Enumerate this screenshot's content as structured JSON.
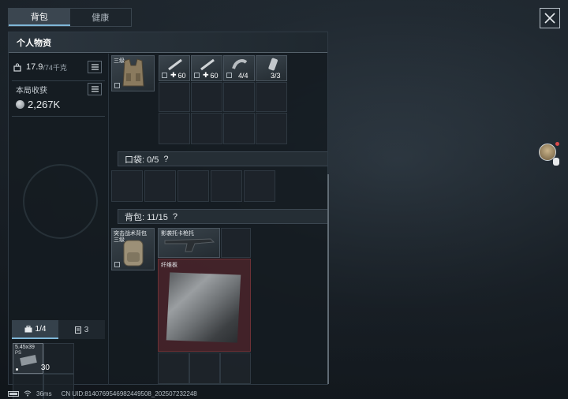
{
  "top_tabs": [
    {
      "label": "背包",
      "active": true
    },
    {
      "label": "健康",
      "active": false
    }
  ],
  "panel": {
    "title": "个人物资",
    "weight_current": "17.9",
    "weight_max": "/74千克",
    "earnings_label": "本局收获",
    "earnings_value": "2,267K"
  },
  "subtabs": [
    {
      "label": "1/4",
      "icon": "toolbox-icon",
      "active": true
    },
    {
      "label": "3",
      "icon": "clipboard-icon",
      "active": false
    }
  ],
  "ammo": {
    "label": "5.45x39",
    "sub": "PS",
    "count": "30"
  },
  "vest_items": [
    {
      "icon": "syringe-icon",
      "badge": "60",
      "badge_icon": "plus"
    },
    {
      "icon": "syringe-icon",
      "badge": "60",
      "badge_icon": "plus"
    },
    {
      "icon": "bandage-icon",
      "badge": "4/4"
    },
    {
      "icon": "canister-icon",
      "badge": "3/3"
    }
  ],
  "vest_tag": "三级",
  "pocket": {
    "label": "口袋: 0/5",
    "help": "?"
  },
  "backpack": {
    "label": "背包: 11/15",
    "help": "?"
  },
  "backpack_items": {
    "bag_name": "突击战术背包",
    "bag_sub": "三级",
    "gun_name": "影袭托卡枪托",
    "plate_name": "纤维板"
  },
  "status": {
    "ping": "36ms",
    "uid": "CN UID:8140769546982449508_202507232248"
  },
  "colors": {
    "accent": "#7fb7d8",
    "danger_bg": "#602830",
    "panel_bg": "#141b21"
  }
}
